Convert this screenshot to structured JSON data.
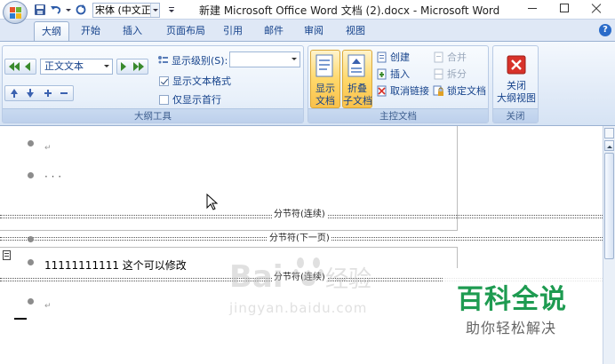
{
  "window": {
    "title": "新建 Microsoft Office Word 文档 (2).docx - Microsoft Word",
    "font_name": "宋体 (中文正文"
  },
  "tabs": [
    {
      "label": "大纲",
      "active": true
    },
    {
      "label": "开始"
    },
    {
      "label": "插入"
    },
    {
      "label": "页面布局"
    },
    {
      "label": "引用"
    },
    {
      "label": "邮件"
    },
    {
      "label": "审阅"
    },
    {
      "label": "视图"
    }
  ],
  "help_label": "?",
  "outline_tools": {
    "level_value": "正文文本",
    "show_level_label": "显示级别(S):",
    "show_level_value": "",
    "show_text_format_label": "显示文本格式",
    "show_text_format_checked": true,
    "first_line_only_label": "仅显示首行",
    "first_line_only_checked": false,
    "group_label": "大纲工具"
  },
  "master_document": {
    "show_doc_label": [
      "显示",
      "文档"
    ],
    "collapse_label": [
      "折叠",
      "子文档"
    ],
    "create_label": "创建",
    "insert_label": "插入",
    "unlink_label": "取消链接",
    "merge_label": "合并",
    "split_label": "拆分",
    "lock_label": "锁定文档",
    "group_label": "主控文档"
  },
  "close_group": {
    "close_label": [
      "关闭",
      "大纲视图"
    ],
    "group_label": "关闭"
  },
  "document": {
    "paragraph_mark": "↵",
    "ellipsis": "·  ·  ·",
    "break_continuous_1": "分节符(连续)",
    "break_next_page": "分节符(下一页)",
    "break_continuous_2": "分节符(连续)",
    "body_line": "11111111111 这个可以修改"
  },
  "watermarks": {
    "baidu_word": "Bai",
    "baidu_suffix": "经验",
    "baidu_url": "jingyan.baidu.com",
    "brand_title": "百科全说",
    "brand_subtitle": "助你轻松解决"
  },
  "colors": {
    "ribbon_text": "#15428b",
    "hot_button": "#ffd86b",
    "close_red": "#d8322a",
    "brand_green": "#1e9b51"
  }
}
